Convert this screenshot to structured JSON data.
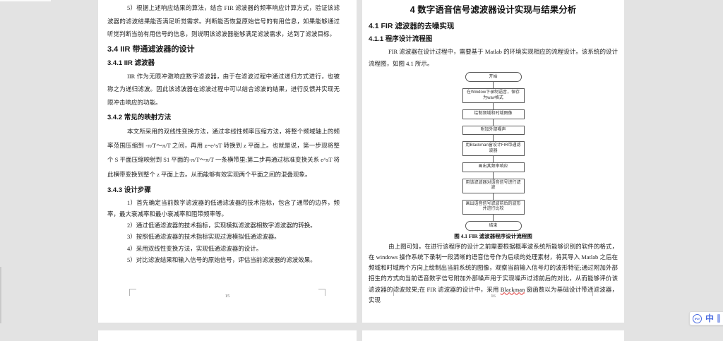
{
  "colors": {
    "canvas_bg": "#e3e3e3",
    "page_bg": "#ffffff",
    "text": "#222222",
    "accent_blue": "#4a6be0",
    "spell_underline_red": "#e03131"
  },
  "ime": {
    "logo_icon": "ifly-logo-icon",
    "logo_text": "iFLY",
    "mode_label": "中"
  },
  "left_page": {
    "page_number": "15",
    "top_paragraph": "5）根据上述响应结果的算法，结合 FIR 滤波器的频率响应计算方式，验证该滤波器的滤波结果能否满足听觉需求。判断能否恢复原始信号的有用信息，如果能够通过听觉判断当前有用信号的信息，则说明该滤波器能够满足滤波需求，达到了滤波目标。",
    "h_34": "3.4 IIR 带通滤波器的设计",
    "h_341": "3.4.1 IIR 滤波器",
    "para_341": "IIR 作为无限冲激响应数字滤波器，由于在滤波过程中通过递归方式进行，也被称之为递归滤波。因此该滤波器在滤波过程中可以结合滤波的结果，进行反馈并实现无限冲击响应的功能。",
    "h_342": "3.4.2 常见的映射方法",
    "para_342": "本文所采用的双线性变换方法，通过非线性频率压缩方法，将整个频域轴上的频率范围压缩到 -π/T～π/T 之间，再用 z=e^sT 转换到 z 平面上。也就是说，第一步现将整个 S 平面压缩映射到 S1 平面的-π/T～π/T 一条横带里;第二步再通过标准变换关系 e^sT 将此横带变换到整个 z 平面上去。从而能够有效实现两个平面之间的混叠现象。",
    "h_343": "3.4.3 设计步骤",
    "steps": [
      "1）首先确定当前数字滤波器的低通滤波器的技术指标，包含了通带的边界，频率，最大衰减率和最小衰减率和阻带频率等。",
      "2）通过低通滤波器的技术指标，实现模拟滤波器相数字滤波器的转换。",
      "3）按照低通滤波器的技术指标实现过渡模拟低通滤波器。",
      "4）采用双线性变换方法，实现低通滤波器的设计。",
      "5）对比滤波结果和输入信号的原始信号，评估当前滤波器的滤波效果。"
    ]
  },
  "right_page": {
    "page_number": "16",
    "chapter_title": "4 数字语音信号滤波器设计实现与结果分析",
    "section_title": "4.1 FIR 滤波器的去噪实现",
    "subsection_title": "4.1.1 程序设计流程图",
    "intro_paragraph": "FIR 滤波器在设计过程中，需要基于 Matlab 的环境实现相应的流程设计。该系统的设计流程图，如图 4.1 所示。",
    "flowchart": {
      "nodes": [
        {
          "type": "terminator",
          "label": "开始"
        },
        {
          "type": "process",
          "label": "在Window下录制语音，保存为wav格式"
        },
        {
          "type": "process",
          "label": "绘制频域和时域图像"
        },
        {
          "type": "process",
          "label": "附加外部噪声"
        },
        {
          "type": "process",
          "label": "用Blackman窗设计FIR带通滤波器"
        },
        {
          "type": "process",
          "label": "画出其频率响应"
        },
        {
          "type": "process",
          "label": "用该滤波器对语音信号进行滤波"
        },
        {
          "type": "process",
          "label": "画出语音信号滤波前后的波形并进行比较"
        },
        {
          "type": "terminator",
          "label": "结束"
        }
      ]
    },
    "figure_caption": "图 4.1 FIR 滤波器程序设计流程图",
    "body_pre": "由上图可知，在进行该程序的设计之前需要根据概率波系统所能够识别的软件的格式，在 windows 操作系统下录制一段清晰的语音信号作为后续的处理素材，将其导入 Matlab 之后在频域和时域两个方向上绘制出当前系统的图像，观察当前输入信号灯的波形特征;通过附加外部招生的方式向当前语音数字信号附加外部噪声用于实现噪声过滤前后的对比，从而能够评价该滤波器的滤波效果;在 FIR 滤波器的设计中，采用 ",
    "body_spell": "Blackman",
    "body_post": " 窗函数以为基础设计带通滤波器，实现"
  }
}
